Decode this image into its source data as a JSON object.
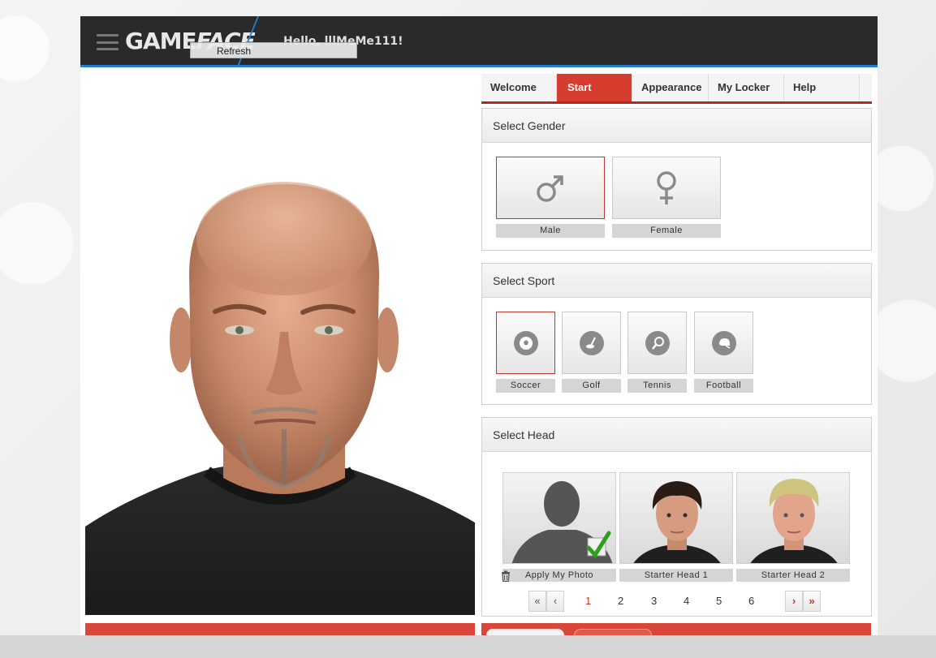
{
  "header": {
    "logo_game": "GAME",
    "logo_face": "FACE",
    "tooltip": "Refresh",
    "greeting": "Hello, lllMeMe111!"
  },
  "tabs": [
    {
      "label": "Welcome"
    },
    {
      "label": "Start"
    },
    {
      "label": "Appearance"
    },
    {
      "label": "My Locker"
    },
    {
      "label": "Help"
    }
  ],
  "active_tab": "Start",
  "gender": {
    "title": "Select Gender",
    "options": [
      {
        "label": "Male",
        "icon": "male-symbol-icon",
        "selected": true
      },
      {
        "label": "Female",
        "icon": "female-symbol-icon",
        "selected": false
      }
    ]
  },
  "sport": {
    "title": "Select Sport",
    "options": [
      {
        "label": "Soccer",
        "icon": "soccer-ball-icon",
        "selected": true
      },
      {
        "label": "Golf",
        "icon": "golf-icon",
        "selected": false
      },
      {
        "label": "Tennis",
        "icon": "tennis-racket-icon",
        "selected": false
      },
      {
        "label": "Football",
        "icon": "football-helmet-icon",
        "selected": false
      }
    ]
  },
  "head": {
    "title": "Select Head",
    "options": [
      {
        "label": "Apply My Photo",
        "selected": true
      },
      {
        "label": "Starter Head 1",
        "selected": false
      },
      {
        "label": "Starter Head 2",
        "selected": false
      }
    ],
    "pager": {
      "first": "«",
      "prev": "‹",
      "pages": [
        "1",
        "2",
        "3",
        "4",
        "5",
        "6"
      ],
      "current": "1",
      "next": "›",
      "last": "»"
    }
  },
  "colors": {
    "accent_red": "#d63d2f",
    "header_bg": "#2a2a2a",
    "header_accent": "#1e7fd0"
  }
}
